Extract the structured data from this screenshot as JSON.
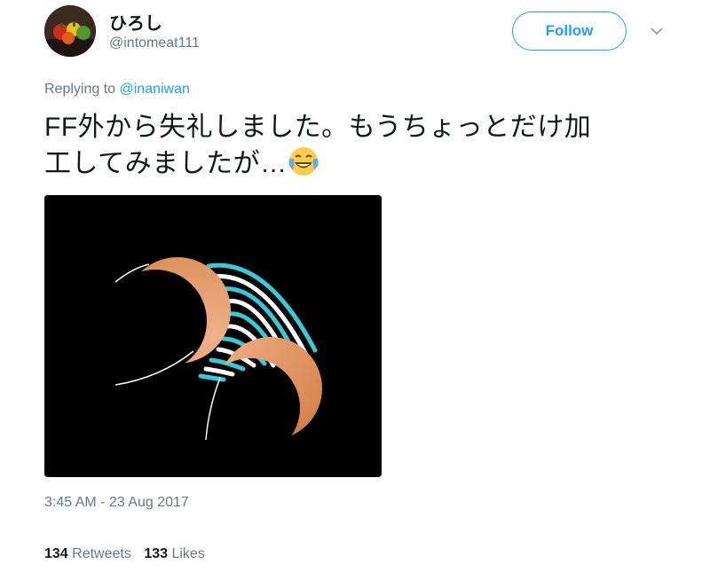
{
  "user": {
    "display_name": "ひろし",
    "handle": "@intomeat111",
    "follow_label": "Follow"
  },
  "reply": {
    "prefix": "Replying to ",
    "mention": "@inaniwan"
  },
  "tweet": {
    "line1": "FF外から失礼しました。もうちょっとだけ加",
    "line2": "工してみましたが…",
    "emoji": "face-with-tears-of-joy",
    "media_icon": "eclipse-edited-image",
    "timestamp": "3:45 AM - 23 Aug 2017"
  },
  "stats": {
    "retweets_count": "134",
    "retweets_label": "Retweets",
    "likes_count": "133",
    "likes_label": "Likes"
  },
  "colors": {
    "accent": "#1da1f2",
    "muted": "#657786",
    "text": "#14171a"
  }
}
